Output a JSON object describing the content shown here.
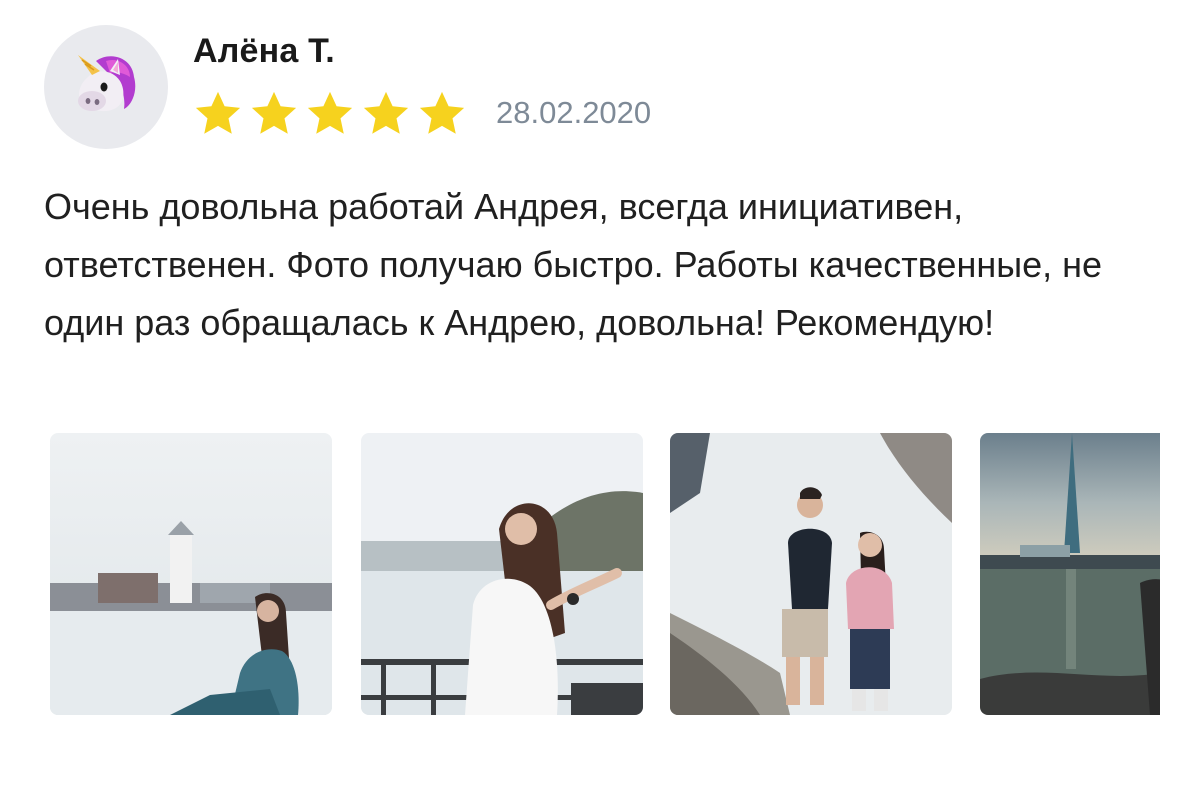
{
  "review": {
    "author": "Алёна Т.",
    "avatar_icon": "unicorn-icon",
    "rating": 5,
    "rating_max": 5,
    "star_color": "#f6d21e",
    "date": "28.02.2020",
    "text": "Очень довольна работай Андрея, всегда инициативен, ответственен. Фото получаю быстро. Работы качественные, не один раз обращалась к Андрею, довольна! Рекомендую!"
  },
  "photos": [
    {
      "name": "photo-woman-sitting-by-water"
    },
    {
      "name": "photo-woman-at-railing"
    },
    {
      "name": "photo-couple-on-rocks"
    },
    {
      "name": "photo-tower-by-water"
    }
  ]
}
